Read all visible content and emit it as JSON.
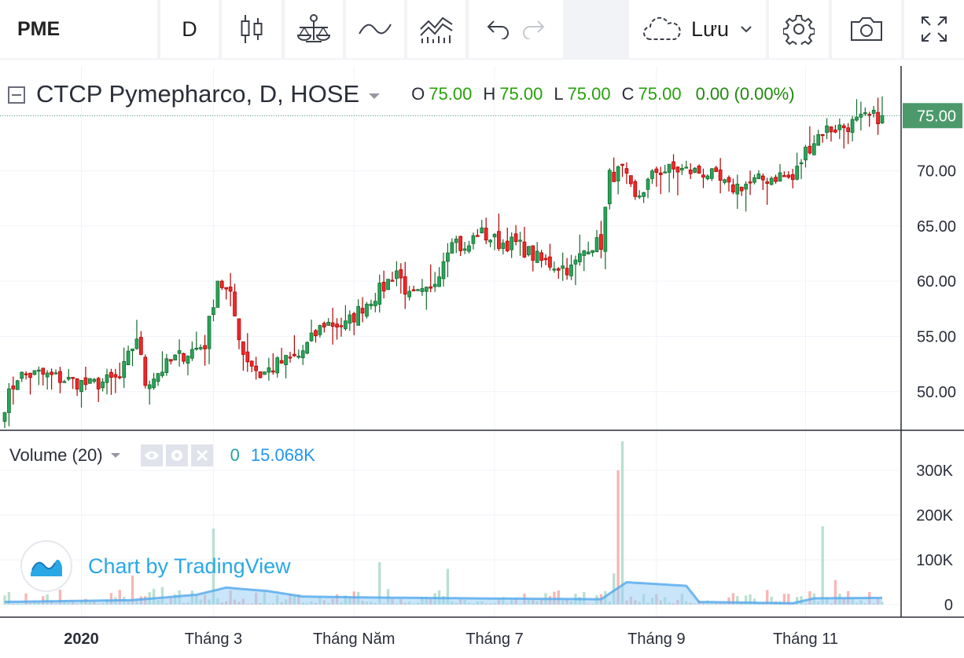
{
  "toolbar": {
    "symbol": "PME",
    "interval": "D",
    "save_label": "Lưu"
  },
  "legend": {
    "title": "CTCP Pymepharco, D, HOSE",
    "ohlc": [
      {
        "key": "O",
        "value": "75.00"
      },
      {
        "key": "H",
        "value": "75.00"
      },
      {
        "key": "L",
        "value": "75.00"
      },
      {
        "key": "C",
        "value": "75.00"
      }
    ],
    "change": "0.00 (0.00%)"
  },
  "volume_legend": {
    "title": "Volume (20)",
    "zero": "0",
    "value": "15.068K"
  },
  "watermark": "Chart by TradingView",
  "colors": {
    "up": "#26a65b",
    "down": "#ef2a2a",
    "up_border": "#166a2c",
    "down_border": "#b20000",
    "vol_up": "#b9e0cf",
    "vol_down": "#f6b7b7",
    "vol_ma_fill": "#9dd0f4",
    "vol_ma_line": "#53a9ee",
    "last_price_bg": "#4c9a6c",
    "grid": "#f0f3fa",
    "text_axis": "#2a2e39"
  },
  "chart_data": {
    "type": "candlestick",
    "symbol": "PME",
    "exchange": "HOSE",
    "interval": "D",
    "last_price": 75.0,
    "price_axis": {
      "ticks": [
        "50.00",
        "55.00",
        "60.00",
        "65.00",
        "70.00",
        "75.00"
      ],
      "range": [
        46.5,
        79.5
      ]
    },
    "volume_axis": {
      "ticks": [
        "0",
        "100K",
        "200K",
        "300K"
      ],
      "range": [
        0,
        365000
      ]
    },
    "time_axis": {
      "labels": [
        {
          "label": "2020",
          "bold": true,
          "index": 18
        },
        {
          "label": "Tháng 3",
          "index": 49
        },
        {
          "label": "Tháng Năm",
          "index": 82
        },
        {
          "label": "Tháng 7",
          "index": 115
        },
        {
          "label": "Tháng 9",
          "index": 153
        },
        {
          "label": "Tháng 11",
          "index": 188
        }
      ]
    },
    "close_anchors": [
      [
        0,
        48.8
      ],
      [
        3,
        51.4
      ],
      [
        8,
        51.6
      ],
      [
        14,
        51.1
      ],
      [
        20,
        50.6
      ],
      [
        27,
        51.2
      ],
      [
        31,
        55.0
      ],
      [
        33,
        50.8
      ],
      [
        40,
        53.0
      ],
      [
        47,
        54.3
      ],
      [
        50,
        60.2
      ],
      [
        53,
        58.5
      ],
      [
        56,
        53.5
      ],
      [
        60,
        51.5
      ],
      [
        64,
        52.5
      ],
      [
        69,
        53.2
      ],
      [
        75,
        56.2
      ],
      [
        80,
        56.0
      ],
      [
        84,
        57.7
      ],
      [
        89,
        59.5
      ],
      [
        92,
        61.0
      ],
      [
        95,
        58.5
      ],
      [
        100,
        59.0
      ],
      [
        105,
        64.2
      ],
      [
        108,
        62.6
      ],
      [
        111,
        64.5
      ],
      [
        116,
        63.5
      ],
      [
        120,
        63.4
      ],
      [
        126,
        61.8
      ],
      [
        133,
        61.1
      ],
      [
        137,
        63.3
      ],
      [
        140,
        63.4
      ],
      [
        142,
        69.5
      ],
      [
        145,
        70.0
      ],
      [
        148,
        67.3
      ],
      [
        153,
        70.0
      ],
      [
        158,
        70.1
      ],
      [
        165,
        69.8
      ],
      [
        170,
        68.4
      ],
      [
        177,
        69.1
      ],
      [
        182,
        69.6
      ],
      [
        185,
        69.2
      ],
      [
        188,
        71.8
      ],
      [
        192,
        73.7
      ],
      [
        197,
        74.0
      ],
      [
        202,
        74.7
      ],
      [
        206,
        75.0
      ]
    ],
    "volume_ma20_approx": [
      [
        0,
        6000
      ],
      [
        30,
        10000
      ],
      [
        45,
        22000
      ],
      [
        52,
        38000
      ],
      [
        62,
        30000
      ],
      [
        70,
        18000
      ],
      [
        85,
        16000
      ],
      [
        110,
        14000
      ],
      [
        140,
        12000
      ],
      [
        146,
        50000
      ],
      [
        160,
        42000
      ],
      [
        163,
        6000
      ],
      [
        185,
        3000
      ],
      [
        190,
        14000
      ],
      [
        206,
        15068
      ]
    ],
    "volume_spikes": [
      {
        "index": 145,
        "volume": 365000,
        "dir": "up"
      },
      {
        "index": 144,
        "volume": 300000,
        "dir": "down"
      },
      {
        "index": 49,
        "volume": 170000,
        "dir": "up"
      },
      {
        "index": 192,
        "volume": 175000,
        "dir": "up"
      },
      {
        "index": 143,
        "volume": 70000,
        "dir": "up"
      },
      {
        "index": 30,
        "volume": 65000,
        "dir": "down"
      },
      {
        "index": 88,
        "volume": 95000,
        "dir": "up"
      },
      {
        "index": 104,
        "volume": 80000,
        "dir": "up"
      },
      {
        "index": 195,
        "volume": 55000,
        "dir": "down"
      }
    ]
  }
}
